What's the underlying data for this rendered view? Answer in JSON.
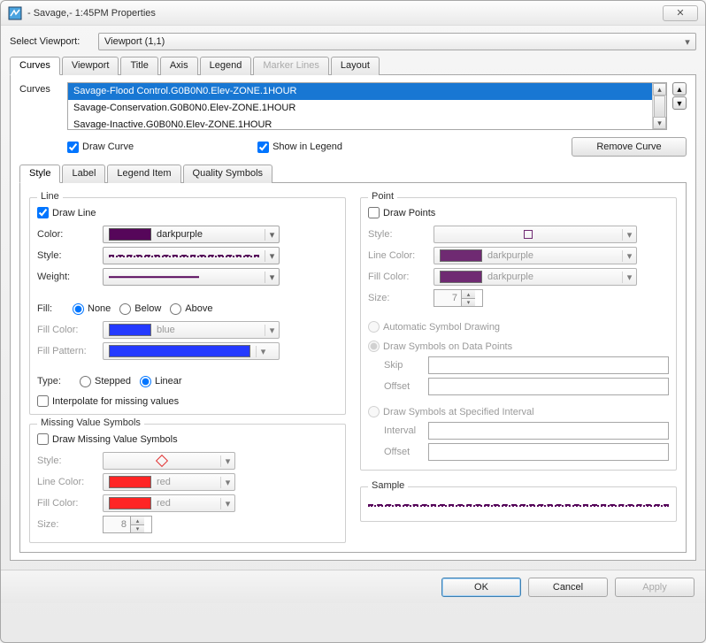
{
  "window": {
    "title": "- Savage,- 1:45PM Properties"
  },
  "viewportSelector": {
    "label": "Select Viewport:",
    "value": "Viewport (1,1)"
  },
  "mainTabs": [
    "Curves",
    "Viewport",
    "Title",
    "Axis",
    "Legend",
    "Marker Lines",
    "Layout"
  ],
  "mainTabsDisabledIndex": 5,
  "curves": {
    "label": "Curves",
    "items": [
      "Savage-Flood Control.G0B0N0.Elev-ZONE.1HOUR",
      "Savage-Conservation.G0B0N0.Elev-ZONE.1HOUR",
      "Savage-Inactive.G0B0N0.Elev-ZONE.1HOUR"
    ],
    "selectedIndex": 0,
    "drawCurve": "Draw Curve",
    "showInLegend": "Show in Legend",
    "removeCurve": "Remove Curve"
  },
  "subTabs": [
    "Style",
    "Label",
    "Legend Item",
    "Quality Symbols"
  ],
  "line": {
    "legend": "Line",
    "drawLine": "Draw Line",
    "colorLabel": "Color:",
    "colorName": "darkpurple",
    "colorHex": "#56065a",
    "styleLabel": "Style:",
    "weightLabel": "Weight:",
    "fillLabel": "Fill:",
    "fillNone": "None",
    "fillBelow": "Below",
    "fillAbove": "Above",
    "fillColorLabel": "Fill Color:",
    "fillColorName": "blue",
    "fillColorHex": "#0018ff",
    "fillPatternLabel": "Fill Pattern:",
    "typeLabel": "Type:",
    "typeStepped": "Stepped",
    "typeLinear": "Linear",
    "interpolate": "Interpolate for missing values"
  },
  "missing": {
    "legend": "Missing Value Symbols",
    "drawMissing": "Draw Missing Value Symbols",
    "styleLabel": "Style:",
    "lineColorLabel": "Line Color:",
    "lineColorName": "red",
    "lineColorHex": "#ff0000",
    "fillColorLabel": "Fill Color:",
    "fillColorName": "red",
    "fillColorHex": "#ff0000",
    "sizeLabel": "Size:",
    "sizeValue": "8"
  },
  "point": {
    "legend": "Point",
    "drawPoints": "Draw Points",
    "styleLabel": "Style:",
    "lineColorLabel": "Line Color:",
    "lineColorName": "darkpurple",
    "lineColorHex": "#56065a",
    "fillColorLabel": "Fill Color:",
    "fillColorName": "darkpurple",
    "fillColorHex": "#56065a",
    "sizeLabel": "Size:",
    "sizeValue": "7",
    "autoSymbol": "Automatic Symbol Drawing",
    "drawOnData": "Draw Symbols on Data Points",
    "skipLabel": "Skip",
    "offsetLabel": "Offset",
    "drawAtInterval": "Draw Symbols at Specified Interval",
    "intervalLabel": "Interval",
    "offset2Label": "Offset"
  },
  "sampleLabel": "Sample",
  "buttons": {
    "ok": "OK",
    "cancel": "Cancel",
    "apply": "Apply"
  }
}
